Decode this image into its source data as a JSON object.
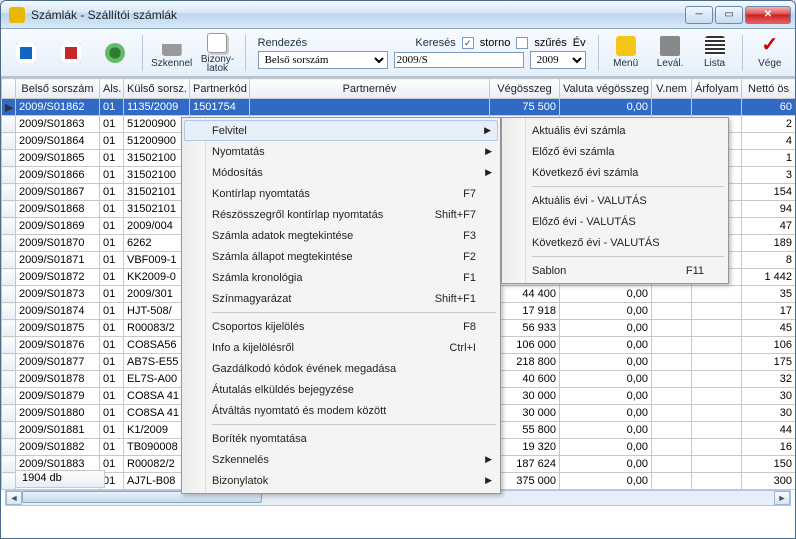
{
  "window": {
    "title": "Számlák - Szállítói számlák"
  },
  "toolbar": {
    "scan": "Szkennel",
    "docs": "Bizony-\nlatok",
    "sort_label": "Rendezés",
    "sort_value": "Belső sorszám",
    "search_label": "Keresés",
    "search_value": "2009/S",
    "storno": "storno",
    "szures": "szűrés",
    "ev": "Év",
    "year": "2009",
    "menu": "Menü",
    "leval": "Levál.",
    "lista": "Lista",
    "vege": "Vége"
  },
  "columns": [
    "",
    "Belső sorszám",
    "Als.",
    "Külső sorsz.",
    "Partnerkód",
    "Partnernév",
    "Végösszeg",
    "Valuta végösszeg",
    "V.nem",
    "Árfolyam",
    "Nettó ös"
  ],
  "rows": [
    {
      "sel": true,
      "b": "2009/S01862",
      "a": "01",
      "k": "1135/2009",
      "p": "1501754",
      "n": "",
      "veg": "75 500",
      "val": "0,00",
      "netto": "60"
    },
    {
      "b": "2009/S01863",
      "a": "01",
      "k": "51200900",
      "veg": "",
      "val": "",
      "netto": "2"
    },
    {
      "b": "2009/S01864",
      "a": "01",
      "k": "51200900",
      "veg": "",
      "val": "",
      "netto": "4"
    },
    {
      "b": "2009/S01865",
      "a": "01",
      "k": "31502100",
      "veg": "",
      "val": "",
      "netto": "1"
    },
    {
      "b": "2009/S01866",
      "a": "01",
      "k": "31502100",
      "veg": "",
      "val": "",
      "netto": "3"
    },
    {
      "b": "2009/S01867",
      "a": "01",
      "k": "31502101",
      "veg": "",
      "val": "",
      "netto": "154"
    },
    {
      "b": "2009/S01868",
      "a": "01",
      "k": "31502101",
      "veg": "",
      "val": "",
      "netto": "94"
    },
    {
      "b": "2009/S01869",
      "a": "01",
      "k": "2009/004",
      "veg": "",
      "val": "",
      "netto": "47"
    },
    {
      "b": "2009/S01870",
      "a": "01",
      "k": "6262",
      "veg": "",
      "val": "",
      "netto": "189"
    },
    {
      "b": "2009/S01871",
      "a": "01",
      "k": "VBF009-1",
      "veg": "",
      "val": "",
      "netto": "8"
    },
    {
      "b": "2009/S01872",
      "a": "01",
      "k": "KK2009-0",
      "veg": "",
      "val": "",
      "netto": "1 442"
    },
    {
      "b": "2009/S01873",
      "a": "01",
      "k": "2009/301",
      "veg": "44 400",
      "val": "0,00",
      "netto": "35"
    },
    {
      "b": "2009/S01874",
      "a": "01",
      "k": "HJT-508/",
      "veg": "17 918",
      "val": "0,00",
      "netto": "17"
    },
    {
      "b": "2009/S01875",
      "a": "01",
      "k": "R00083/2",
      "veg": "56 933",
      "val": "0,00",
      "netto": "45"
    },
    {
      "b": "2009/S01876",
      "a": "01",
      "k": "CO8SA56",
      "veg": "106 000",
      "val": "0,00",
      "netto": "106"
    },
    {
      "b": "2009/S01877",
      "a": "01",
      "k": "AB7S-E55",
      "veg": "218 800",
      "val": "0,00",
      "netto": "175"
    },
    {
      "b": "2009/S01878",
      "a": "01",
      "k": "EL7S-A00",
      "veg": "40 600",
      "val": "0,00",
      "netto": "32"
    },
    {
      "b": "2009/S01879",
      "a": "01",
      "k": "CO8SA 41",
      "veg": "30 000",
      "val": "0,00",
      "netto": "30"
    },
    {
      "b": "2009/S01880",
      "a": "01",
      "k": "CO8SA 41",
      "veg": "30 000",
      "val": "0,00",
      "netto": "30"
    },
    {
      "b": "2009/S01881",
      "a": "01",
      "k": "K1/2009",
      "veg": "55 800",
      "val": "0,00",
      "netto": "44"
    },
    {
      "b": "2009/S01882",
      "a": "01",
      "k": "TB090008",
      "veg": "19 320",
      "val": "0,00",
      "netto": "16"
    },
    {
      "b": "2009/S01883",
      "a": "01",
      "k": "R00082/2",
      "veg": "187 624",
      "val": "0,00",
      "netto": "150"
    },
    {
      "b": "2009/S01884",
      "a": "01",
      "k": "AJ7L-B08",
      "veg": "375 000",
      "val": "0,00",
      "netto": "300"
    }
  ],
  "footer": "1904 db",
  "menu1": [
    {
      "t": "Felvitel",
      "arr": true,
      "hover": true
    },
    {
      "t": "Nyomtatás",
      "arr": true
    },
    {
      "t": "Módosítás",
      "arr": true
    },
    {
      "t": "Kontírlap nyomtatás",
      "sc": "F7"
    },
    {
      "t": "Részösszegről kontírlap nyomtatás",
      "sc": "Shift+F7"
    },
    {
      "t": "Számla adatok megtekintése",
      "sc": "F3"
    },
    {
      "t": "Számla állapot megtekintése",
      "sc": "F2"
    },
    {
      "t": "Számla kronológia",
      "sc": "F1"
    },
    {
      "t": "Színmagyarázat",
      "sc": "Shift+F1"
    },
    {
      "sep": true
    },
    {
      "t": "Csoportos kijelölés",
      "sc": "F8"
    },
    {
      "t": "Info a kijelölésről",
      "sc": "Ctrl+I"
    },
    {
      "t": "Gazdálkodó kódok évének megadása"
    },
    {
      "t": "Átutalás elküldés bejegyzése"
    },
    {
      "t": "Átváltás nyomtató és modem között"
    },
    {
      "sep": true
    },
    {
      "t": "Boríték nyomtatása"
    },
    {
      "t": "Szkennelés",
      "arr": true
    },
    {
      "t": "Bizonylatok",
      "arr": true
    }
  ],
  "menu2": [
    {
      "t": "Aktuális évi számla"
    },
    {
      "t": "Előző évi számla"
    },
    {
      "t": "Következő évi számla"
    },
    {
      "sep": true
    },
    {
      "t": "Aktuális évi - VALUTÁS"
    },
    {
      "t": "Előző évi - VALUTÁS"
    },
    {
      "t": "Következő évi - VALUTÁS"
    },
    {
      "sep": true
    },
    {
      "t": "Sablon",
      "sc": "F11"
    }
  ]
}
